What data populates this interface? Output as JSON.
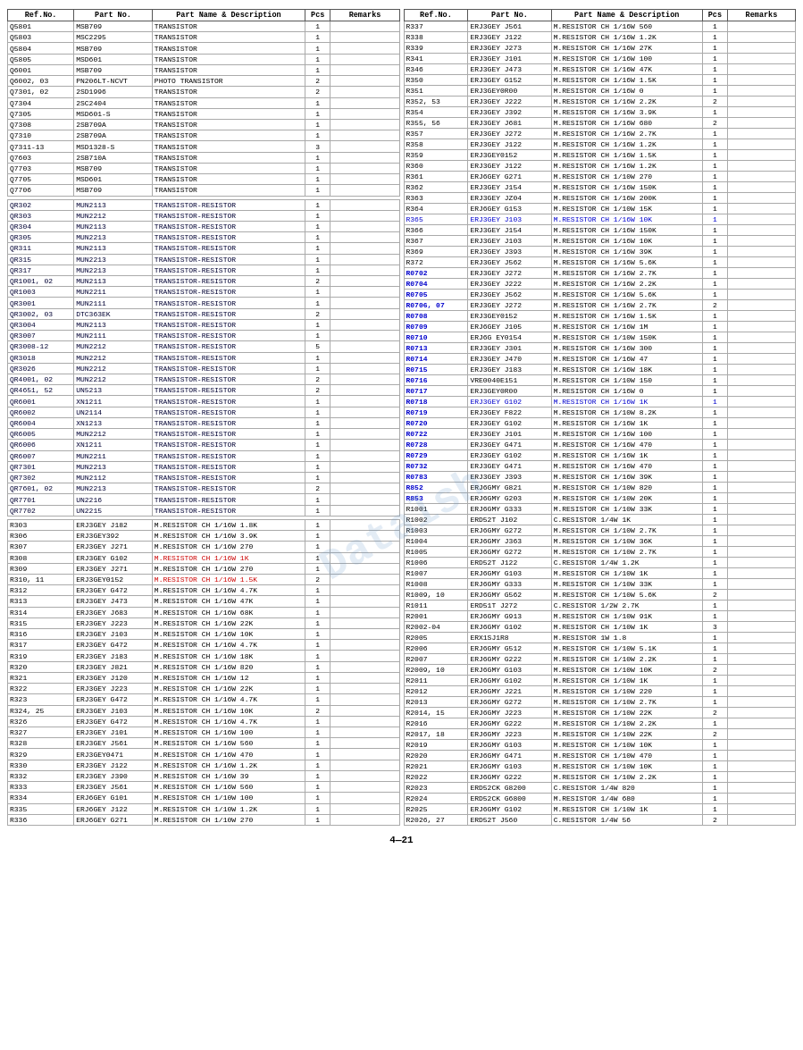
{
  "watermark": "Datalsh",
  "footer": "4—21",
  "left_headers": [
    "Ref.No.",
    "Part No.",
    "Part Name & Description",
    "Pcs",
    "Remarks"
  ],
  "right_headers": [
    "Ref.No.",
    "Part No.",
    "Part Name & Description",
    "Pcs",
    "Remarks"
  ],
  "left_rows": [
    [
      "Q5801",
      "MSB709",
      "TRANSISTOR",
      "1",
      ""
    ],
    [
      "Q5803",
      "MSC2295",
      "TRANSISTOR",
      "1",
      ""
    ],
    [
      "Q5804",
      "MSB709",
      "TRANSISTOR",
      "1",
      ""
    ],
    [
      "Q5805",
      "MSD601",
      "TRANSISTOR",
      "1",
      ""
    ],
    [
      "Q6001",
      "MSB709",
      "TRANSISTOR",
      "1",
      ""
    ],
    [
      "Q6002, 03",
      "PN206LT-NCVT",
      "PHOTO TRANSISTOR",
      "2",
      ""
    ],
    [
      "Q7301, 02",
      "2SD1996",
      "TRANSISTOR",
      "2",
      ""
    ],
    [
      "Q7304",
      "2SC2404",
      "TRANSISTOR",
      "1",
      ""
    ],
    [
      "Q7305",
      "MSD601-S",
      "TRANSISTOR",
      "1",
      ""
    ],
    [
      "Q7308",
      "2SB709A",
      "TRANSISTOR",
      "1",
      ""
    ],
    [
      "Q7310",
      "2SB709A",
      "TRANSISTOR",
      "1",
      ""
    ],
    [
      "Q7311-13",
      "MSD1328-S",
      "TRANSISTOR",
      "3",
      ""
    ],
    [
      "Q7603",
      "2SB710A",
      "TRANSISTOR",
      "1",
      ""
    ],
    [
      "Q7703",
      "MSB709",
      "TRANSISTOR",
      "1",
      ""
    ],
    [
      "Q7705",
      "MSD601",
      "TRANSISTOR",
      "1",
      ""
    ],
    [
      "Q7706",
      "MSB709",
      "TRANSISTOR",
      "1",
      ""
    ],
    [
      "",
      "",
      "",
      "",
      ""
    ],
    [
      "QR302",
      "MUN2113",
      "TRANSISTOR-RESISTOR",
      "1",
      ""
    ],
    [
      "QR303",
      "MUN2212",
      "TRANSISTOR-RESISTOR",
      "1",
      ""
    ],
    [
      "QR304",
      "MUN2113",
      "TRANSISTOR-RESISTOR",
      "1",
      ""
    ],
    [
      "QR305",
      "MUN2213",
      "TRANSISTOR-RESISTOR",
      "1",
      ""
    ],
    [
      "QR311",
      "MUN2113",
      "TRANSISTOR-RESISTOR",
      "1",
      ""
    ],
    [
      "QR315",
      "MUN2213",
      "TRANSISTOR-RESISTOR",
      "1",
      ""
    ],
    [
      "QR317",
      "MUN2213",
      "TRANSISTOR-RESISTOR",
      "1",
      ""
    ],
    [
      "QR1001, 02",
      "MUN2113",
      "TRANSISTOR-RESISTOR",
      "2",
      ""
    ],
    [
      "QR1003",
      "MUN2211",
      "TRANSISTOR-RESISTOR",
      "1",
      ""
    ],
    [
      "QR3001",
      "MUN2111",
      "TRANSISTOR-RESISTOR",
      "1",
      ""
    ],
    [
      "QR3002, 03",
      "DTC363EK",
      "TRANSISTOR-RESISTOR",
      "2",
      ""
    ],
    [
      "QR3004",
      "MUN2113",
      "TRANSISTOR-RESISTOR",
      "1",
      ""
    ],
    [
      "QR3007",
      "MUN2111",
      "TRANSISTOR-RESISTOR",
      "1",
      ""
    ],
    [
      "QR3008-12",
      "MUN2212",
      "TRANSISTOR-RESISTOR",
      "5",
      ""
    ],
    [
      "QR3018",
      "MUN2212",
      "TRANSISTOR-RESISTOR",
      "1",
      ""
    ],
    [
      "QR3026",
      "MUN2212",
      "TRANSISTOR-RESISTOR",
      "1",
      ""
    ],
    [
      "QR4001, 02",
      "MUN2212",
      "TRANSISTOR-RESISTOR",
      "2",
      ""
    ],
    [
      "QR4651, 52",
      "UN5213",
      "TRANSISTOR-RESISTOR",
      "2",
      ""
    ],
    [
      "QR6001",
      "XN1211",
      "TRANSISTOR-RESISTOR",
      "1",
      ""
    ],
    [
      "QR6002",
      "UN2114",
      "TRANSISTOR-RESISTOR",
      "1",
      ""
    ],
    [
      "QR6004",
      "XN1213",
      "TRANSISTOR-RESISTOR",
      "1",
      ""
    ],
    [
      "QR6005",
      "MUN2212",
      "TRANSISTOR-RESISTOR",
      "1",
      ""
    ],
    [
      "QR6006",
      "XN1211",
      "TRANSISTOR-RESISTOR",
      "1",
      ""
    ],
    [
      "QR6007",
      "MUN2211",
      "TRANSISTOR-RESISTOR",
      "1",
      ""
    ],
    [
      "QR7301",
      "MUN2213",
      "TRANSISTOR-RESISTOR",
      "1",
      ""
    ],
    [
      "QR7302",
      "MUN2112",
      "TRANSISTOR-RESISTOR",
      "1",
      ""
    ],
    [
      "QR7601, 02",
      "MUN2213",
      "TRANSISTOR-RESISTOR",
      "2",
      ""
    ],
    [
      "QR7701",
      "UN2216",
      "TRANSISTOR-RESISTOR",
      "1",
      ""
    ],
    [
      "QR7702",
      "UN2215",
      "TRANSISTOR-RESISTOR",
      "1",
      ""
    ],
    [
      "",
      "",
      "",
      "",
      ""
    ],
    [
      "R303",
      "ERJ3GEY J182",
      "M.RESISTOR CH 1/16W  1.8K",
      "1",
      ""
    ],
    [
      "R306",
      "ERJ3GEY392",
      "M.RESISTOR CH 1/16W  3.9K",
      "1",
      ""
    ],
    [
      "R307",
      "ERJ3GEY J271",
      "M.RESISTOR CH 1/16W  270",
      "1",
      ""
    ],
    [
      "R308",
      "ERJ3GEY G102",
      "M.RESISTOR CH 1/16W  1K",
      "1",
      ""
    ],
    [
      "R309",
      "ERJ3GEY J271",
      "M.RESISTOR CH 1/16W  270",
      "1",
      ""
    ],
    [
      "R310, 11",
      "ERJ3GEY0152",
      "M.RESISTOR CH 1/16W  1.5K",
      "2",
      ""
    ],
    [
      "R312",
      "ERJ3GEY G472",
      "M.RESISTOR CH 1/16W  4.7K",
      "1",
      ""
    ],
    [
      "R313",
      "ERJ3GEY J473",
      "M.RESISTOR CH 1/16W  47K",
      "1",
      ""
    ],
    [
      "R314",
      "ERJ3GEY J683",
      "M.RESISTOR CH 1/16W  68K",
      "1",
      ""
    ],
    [
      "R315",
      "ERJ3GEY J223",
      "M.RESISTOR CH 1/16W  22K",
      "1",
      ""
    ],
    [
      "R316",
      "ERJ3GEY J103",
      "M.RESISTOR CH 1/16W  10K",
      "1",
      ""
    ],
    [
      "R317",
      "ERJ3GEY G472",
      "M.RESISTOR CH 1/16W  4.7K",
      "1",
      ""
    ],
    [
      "R319",
      "ERJ3GEY J183",
      "M.RESISTOR CH 1/16W  18K",
      "1",
      ""
    ],
    [
      "R320",
      "ERJ3GEY J821",
      "M.RESISTOR CH 1/16W  820",
      "1",
      ""
    ],
    [
      "R321",
      "ERJ3GEY J120",
      "M.RESISTOR CH 1/16W  12",
      "1",
      ""
    ],
    [
      "R322",
      "ERJ3GEY J223",
      "M.RESISTOR CH 1/16W  22K",
      "1",
      ""
    ],
    [
      "R323",
      "ERJ3GEY G472",
      "M.RESISTOR CH 1/16W  4.7K",
      "1",
      ""
    ],
    [
      "R324, 25",
      "ERJ3GEY J103",
      "M.RESISTOR CH 1/16W  10K",
      "2",
      ""
    ],
    [
      "R326",
      "ERJ3GEY G472",
      "M.RESISTOR CH 1/16W  4.7K",
      "1",
      ""
    ],
    [
      "R327",
      "ERJ3GEY J101",
      "M.RESISTOR CH 1/16W  100",
      "1",
      ""
    ],
    [
      "R328",
      "ERJ3GEY J561",
      "M.RESISTOR CH 1/16W  560",
      "1",
      ""
    ],
    [
      "R329",
      "ERJ3GEY0471",
      "M.RESISTOR CH 1/16W  470",
      "1",
      ""
    ],
    [
      "R330",
      "ERJ3GEY J122",
      "M.RESISTOR CH 1/16W  1.2K",
      "1",
      ""
    ],
    [
      "R332",
      "ERJ3GEY J390",
      "M.RESISTOR CH 1/16W  39",
      "1",
      ""
    ],
    [
      "R333",
      "ERJ3GEY J561",
      "M.RESISTOR CH 1/16W  560",
      "1",
      ""
    ],
    [
      "R334",
      "ERJ6GEY G101",
      "M.RESISTOR CH 1/10W  100",
      "1",
      ""
    ],
    [
      "R335",
      "ERJ6GEY J122",
      "M.RESISTOR CH 1/10W  1.2K",
      "1",
      ""
    ],
    [
      "R336",
      "ERJ6GEY G271",
      "M.RESISTOR CH 1/10W  270",
      "1",
      ""
    ]
  ],
  "right_rows": [
    [
      "R337",
      "ERJ3GEY J561",
      "M.RESISTOR CH 1/16W  560",
      "1",
      ""
    ],
    [
      "R338",
      "ERJ3GEY J122",
      "M.RESISTOR CH 1/16W  1.2K",
      "1",
      ""
    ],
    [
      "R339",
      "ERJ3GEY J273",
      "M.RESISTOR CH 1/16W  27K",
      "1",
      ""
    ],
    [
      "R341",
      "ERJ3GEY J101",
      "M.RESISTOR CH 1/16W  100",
      "1",
      ""
    ],
    [
      "R346",
      "ERJ3GEY J473",
      "M.RESISTOR CH 1/16W  47K",
      "1",
      ""
    ],
    [
      "R350",
      "ERJ3GEY G152",
      "M.RESISTOR CH 1/16W  1.5K",
      "1",
      ""
    ],
    [
      "R351",
      "ERJ3GEY0R00",
      "M.RESISTOR CH 1/16W  0",
      "1",
      ""
    ],
    [
      "R352, 53",
      "ERJ3GEY J222",
      "M.RESISTOR CH 1/16W  2.2K",
      "2",
      ""
    ],
    [
      "R354",
      "ERJ3GEY J392",
      "M.RESISTOR CH 1/16W  3.9K",
      "1",
      ""
    ],
    [
      "R355, 56",
      "ERJ3GEY J681",
      "M.RESISTOR CH 1/16W  680",
      "2",
      ""
    ],
    [
      "R357",
      "ERJ3GEY J272",
      "M.RESISTOR CH 1/16W  2.7K",
      "1",
      ""
    ],
    [
      "R358",
      "ERJ3GEY J122",
      "M.RESISTOR CH 1/16W  1.2K",
      "1",
      ""
    ],
    [
      "R359",
      "ERJ3GEY0152",
      "M.RESISTOR CH 1/16W  1.5K",
      "1",
      ""
    ],
    [
      "R360",
      "ERJ3GEY J122",
      "M.RESISTOR CH 1/16W  1.2K",
      "1",
      ""
    ],
    [
      "R361",
      "ERJ6GEY G271",
      "M.RESISTOR CH 1/10W  270",
      "1",
      ""
    ],
    [
      "R362",
      "ERJ3GEY J154",
      "M.RESISTOR CH 1/16W  150K",
      "1",
      ""
    ],
    [
      "R363",
      "ERJ3GEY JZ04",
      "M.RESISTOR CH 1/16W  200K",
      "1",
      ""
    ],
    [
      "R364",
      "ERJ6GEY G153",
      "M.RESISTOR CH 1/10W  15K",
      "1",
      ""
    ],
    [
      "R365",
      "ERJ3GEY J103",
      "M.RESISTOR CH 1/16W  10K",
      "1",
      "highlight"
    ],
    [
      "R366",
      "ERJ3GEY J154",
      "M.RESISTOR CH 1/16W  150K",
      "1",
      ""
    ],
    [
      "R367",
      "ERJ3GEY J103",
      "M.RESISTOR CH 1/16W  10K",
      "1",
      ""
    ],
    [
      "R369",
      "ERJ3GEY J393",
      "M.RESISTOR CH 1/16W  39K",
      "1",
      ""
    ],
    [
      "R372",
      "ERJ3GEY J562",
      "M.RESISTOR CH 1/16W  5.6K",
      "1",
      ""
    ],
    [
      "R0702",
      "ERJ3GEY J272",
      "M.RESISTOR CH 1/16W  2.7K",
      "1",
      ""
    ],
    [
      "R0704",
      "ERJ3GEY J222",
      "M.RESISTOR CH 1/16W  2.2K",
      "1",
      ""
    ],
    [
      "R0705",
      "ERJ3GEY J562",
      "M.RESISTOR CH 1/16W  5.6K",
      "1",
      ""
    ],
    [
      "R0706, 07",
      "ERJ3GEY J272",
      "M.RESISTOR CH 1/16W  2.7K",
      "2",
      ""
    ],
    [
      "R0708",
      "ERJ3GEY0152",
      "M.RESISTOR CH 1/16W  1.5K",
      "1",
      ""
    ],
    [
      "R0709",
      "ERJ6GEY J105",
      "M.RESISTOR CH 1/16W  1M",
      "1",
      ""
    ],
    [
      "R0710",
      "ERJ6G EY0154",
      "M.RESISTOR CH 1/10W  150K",
      "1",
      ""
    ],
    [
      "R0713",
      "ERJ3GEY J301",
      "M.RESISTOR CH 1/16W  300",
      "1",
      ""
    ],
    [
      "R0714",
      "ERJ3GEY J470",
      "M.RESISTOR CH 1/16W  47",
      "1",
      ""
    ],
    [
      "R0715",
      "ERJ3GEY J183",
      "M.RESISTOR CH 1/16W  18K",
      "1",
      ""
    ],
    [
      "R0716",
      "VRE0040E151",
      "M.RESISTOR CH 1/10W  150",
      "1",
      ""
    ],
    [
      "R0717",
      "ERJ3GEY0R00",
      "M.RESISTOR CH 1/16W  0",
      "1",
      ""
    ],
    [
      "R0718",
      "ERJ3GEY G102",
      "M.RESISTOR CH 1/16W  1K",
      "1",
      "highlight"
    ],
    [
      "R0719",
      "ERJ3GEY F822",
      "M.RESISTOR CH 1/10W  8.2K",
      "1",
      ""
    ],
    [
      "R0720",
      "ERJ3GEY G102",
      "M.RESISTOR CH 1/16W  1K",
      "1",
      ""
    ],
    [
      "R0722",
      "ERJ3GEY J101",
      "M.RESISTOR CH 1/16W  100",
      "1",
      ""
    ],
    [
      "R0728",
      "ERJ3GEY G471",
      "M.RESISTOR CH 1/16W  470",
      "1",
      ""
    ],
    [
      "R0729",
      "ERJ3GEY G102",
      "M.RESISTOR CH 1/16W  1K",
      "1",
      ""
    ],
    [
      "R0732",
      "ERJ3GEY G471",
      "M.RESISTOR CH 1/16W  470",
      "1",
      ""
    ],
    [
      "R0783",
      "ERJ3GEY J393",
      "M.RESISTOR CH 1/16W  39K",
      "1",
      ""
    ],
    [
      "R852",
      "ERJ6GMY G821",
      "M.RESISTOR CH 1/10W  820",
      "1",
      ""
    ],
    [
      "R853",
      "ERJ6GMY G203",
      "M.RESISTOR CH 1/10W  20K",
      "1",
      ""
    ],
    [
      "R1001",
      "ERJ6GMY G333",
      "M.RESISTOR CH 1/10W  33K",
      "1",
      ""
    ],
    [
      "R1002",
      "ERD52T J102",
      "C.RESISTOR  1/4W  1K",
      "1",
      ""
    ],
    [
      "R1003",
      "ERJ6GMY G272",
      "M.RESISTOR CH 1/10W  2.7K",
      "1",
      ""
    ],
    [
      "R1004",
      "ERJ6GMY J363",
      "M.RESISTOR CH 1/10W  36K",
      "1",
      ""
    ],
    [
      "R1005",
      "ERJ6GMY G272",
      "M.RESISTOR CH 1/10W  2.7K",
      "1",
      ""
    ],
    [
      "R1006",
      "ERD52T J122",
      "C.RESISTOR  1/4W  1.2K",
      "1",
      ""
    ],
    [
      "R1007",
      "ERJ6GMY G103",
      "M.RESISTOR CH 1/10W  1K",
      "1",
      ""
    ],
    [
      "R1008",
      "ERJ6GMY G333",
      "M.RESISTOR CH 1/10W  33K",
      "1",
      ""
    ],
    [
      "R1009, 10",
      "ERJ6GMY G562",
      "M.RESISTOR CH 1/10W  5.6K",
      "2",
      ""
    ],
    [
      "R1011",
      "ERD51T J272",
      "C.RESISTOR  1/2W  2.7K",
      "1",
      ""
    ],
    [
      "R2001",
      "ERJ6GMY G913",
      "M.RESISTOR CH 1/10W  91K",
      "1",
      ""
    ],
    [
      "R2002-04",
      "ERJ6GMY G102",
      "M.RESISTOR CH 1/10W  1K",
      "3",
      ""
    ],
    [
      "R2005",
      "ERX1SJ1R8",
      "M.RESISTOR  1W  1.8",
      "1",
      ""
    ],
    [
      "R2006",
      "ERJ6GMY G512",
      "M.RESISTOR CH 1/10W  5.1K",
      "1",
      ""
    ],
    [
      "R2007",
      "ERJ6GMY G222",
      "M.RESISTOR CH 1/10W  2.2K",
      "1",
      ""
    ],
    [
      "R2009, 10",
      "ERJ6GMY G103",
      "M.RESISTOR CH 1/10W  10K",
      "2",
      ""
    ],
    [
      "R2011",
      "ERJ6GMY G102",
      "M.RESISTOR CH 1/10W  1K",
      "1",
      ""
    ],
    [
      "R2012",
      "ERJ6GMY J221",
      "M.RESISTOR CH 1/10W  220",
      "1",
      ""
    ],
    [
      "R2013",
      "ERJ6GMY G272",
      "M.RESISTOR CH 1/10W  2.7K",
      "1",
      ""
    ],
    [
      "R2014, 15",
      "ERJ6GMY J223",
      "M.RESISTOR CH 1/10W  22K",
      "2",
      ""
    ],
    [
      "R2016",
      "ERJ6GMY G222",
      "M.RESISTOR CH 1/10W  2.2K",
      "1",
      ""
    ],
    [
      "R2017, 18",
      "ERJ6GMY J223",
      "M.RESISTOR CH 1/10W  22K",
      "2",
      ""
    ],
    [
      "R2019",
      "ERJ6GMY G103",
      "M.RESISTOR CH 1/10W  10K",
      "1",
      ""
    ],
    [
      "R2020",
      "ERJ6GMY G471",
      "M.RESISTOR CH 1/10W  470",
      "1",
      ""
    ],
    [
      "R2021",
      "ERJ6GMY G103",
      "M.RESISTOR CH 1/10W  10K",
      "1",
      ""
    ],
    [
      "R2022",
      "ERJ6GMY G222",
      "M.RESISTOR CH 1/10W  2.2K",
      "1",
      ""
    ],
    [
      "R2023",
      "ERD52CK G8200",
      "C.RESISTOR  1/4W  820",
      "1",
      ""
    ],
    [
      "R2024",
      "ERD52CK G6800",
      "M.RESISTOR  1/4W  680",
      "1",
      ""
    ],
    [
      "R2025",
      "ERJ6GMY G102",
      "M.RESISTOR CH 1/10W  1K",
      "1",
      ""
    ],
    [
      "R2026, 27",
      "ERD52T J560",
      "C.RESISTOR  1/4W  56",
      "2",
      ""
    ]
  ]
}
